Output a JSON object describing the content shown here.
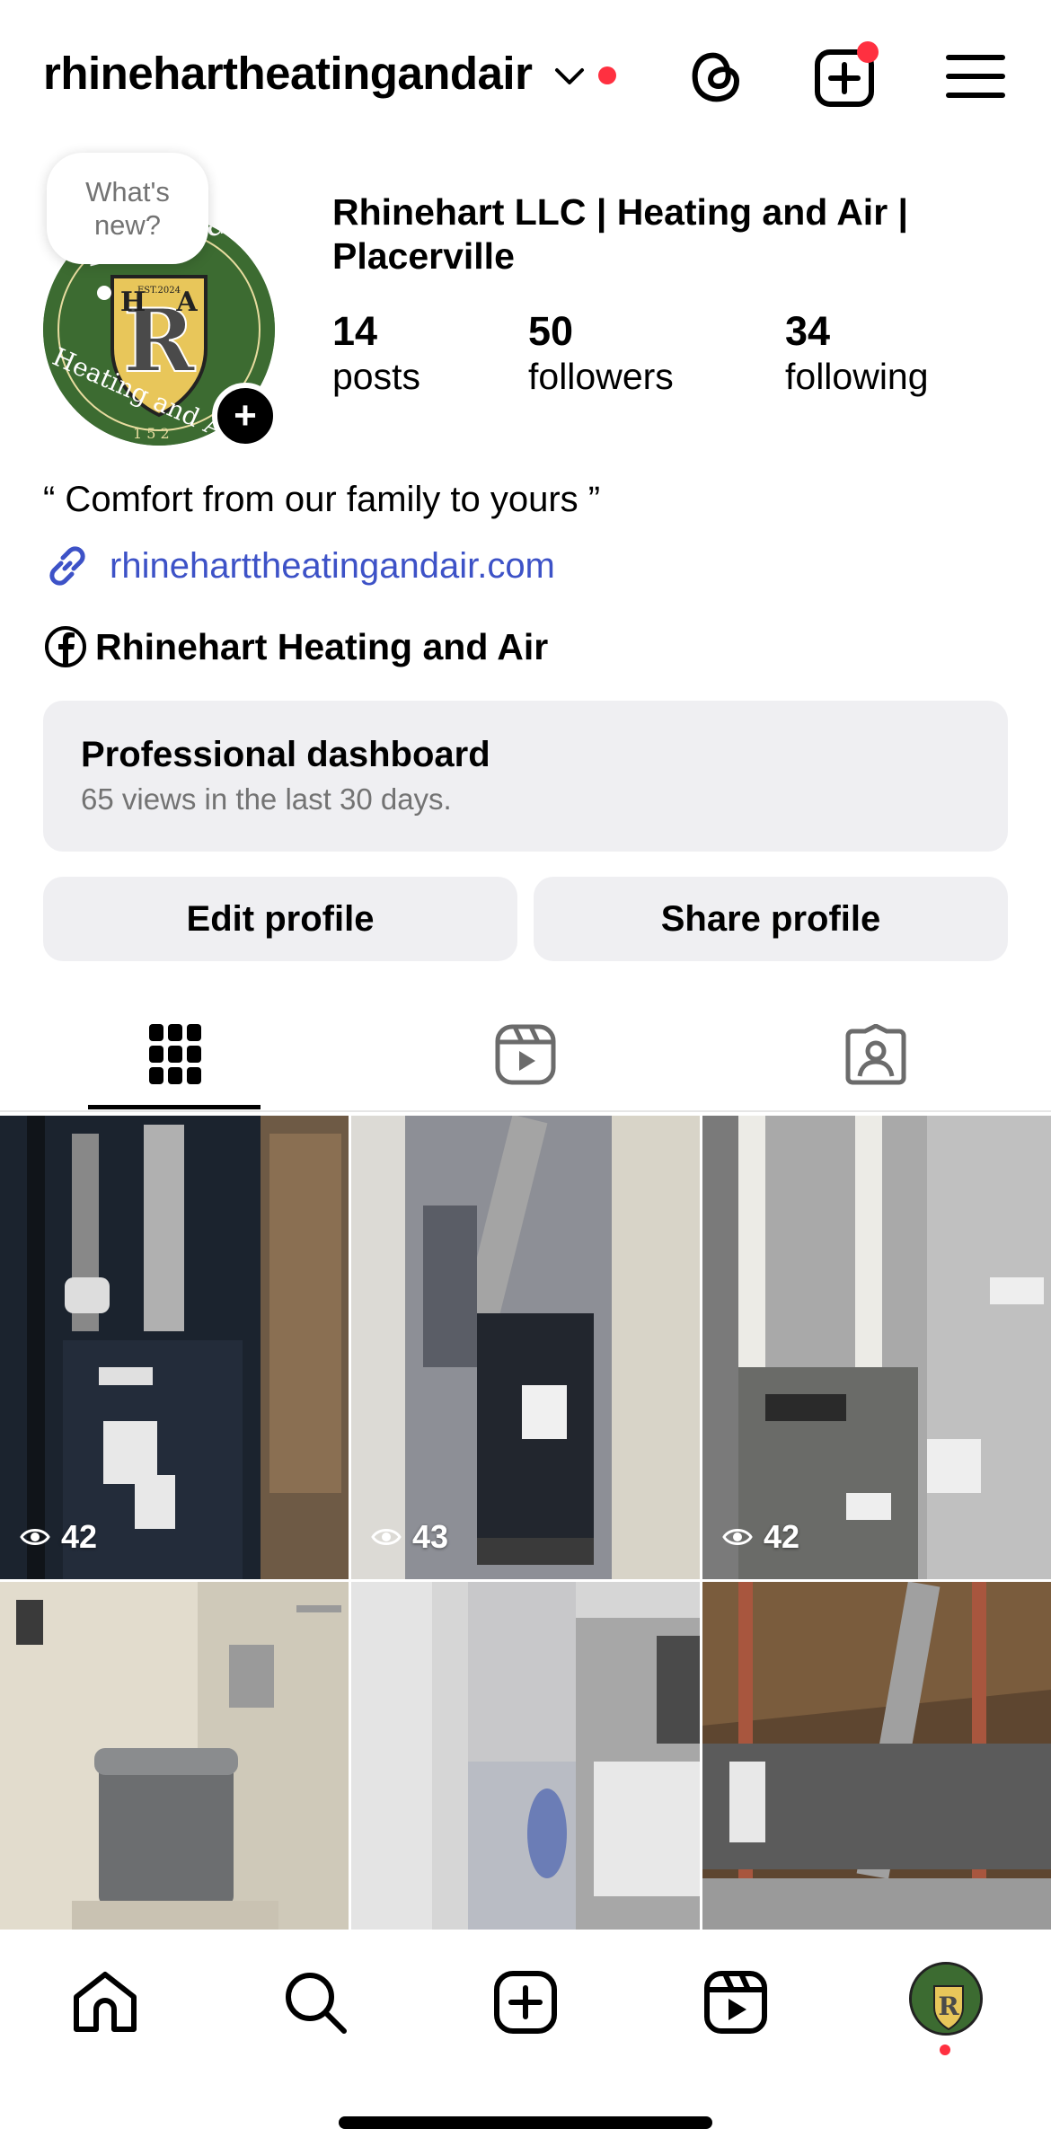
{
  "header": {
    "username": "rhinehartheatingandair"
  },
  "profile": {
    "note_text": "What's new?",
    "display_name": "Rhinehart LLC | Heating and Air | Placerville",
    "stats": [
      {
        "value": "14",
        "label": "posts"
      },
      {
        "value": "50",
        "label": "followers"
      },
      {
        "value": "34",
        "label": "following"
      }
    ],
    "bio": "“ Comfort from our family to yours ”",
    "link": "rhineharttheatingandair.com",
    "facebook_name": "Rhinehart Heating and Air"
  },
  "dashboard": {
    "title": "Professional dashboard",
    "subtitle": "65 views in the last 30 days."
  },
  "buttons": {
    "edit": "Edit profile",
    "share": "Share profile"
  },
  "logo": {
    "top_text": "Rhinehart",
    "bottom_text": "Heating and Air",
    "letters": "HRA",
    "est": "EST.2024",
    "number": "152"
  },
  "grid": [
    {
      "views": "42",
      "colors": [
        "#1c2530",
        "#6e5a45"
      ]
    },
    {
      "views": "43",
      "colors": [
        "#9a9aa0",
        "#2a2d35"
      ]
    },
    {
      "views": "42",
      "colors": [
        "#b8b8b8",
        "#5d5d5d"
      ]
    },
    {
      "views": "",
      "colors": [
        "#d9d4c4",
        "#8d8d8d"
      ]
    },
    {
      "views": "",
      "colors": [
        "#c9c9c9",
        "#e5e5e5"
      ]
    },
    {
      "views": "",
      "colors": [
        "#6f5337",
        "#4a4a4a"
      ]
    }
  ],
  "colors": {
    "accent_link": "#3d52c7",
    "notification": "#ff3040",
    "avatar_bg": "#3c6b31",
    "button_bg": "#efeff2"
  }
}
